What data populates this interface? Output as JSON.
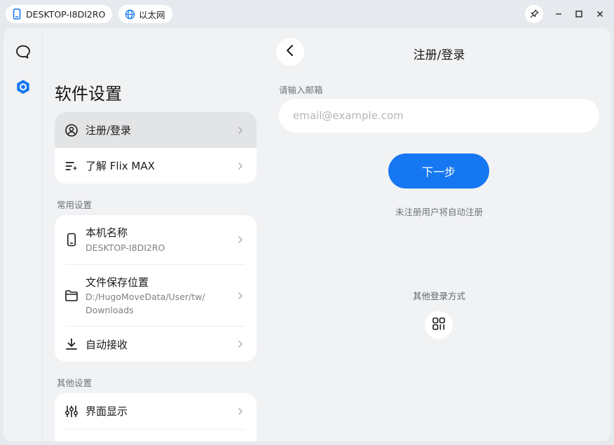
{
  "titlebar": {
    "device_name": "DESKTOP-I8DI2RO",
    "network": "以太网",
    "icons": {
      "device": "phone-icon",
      "network": "globe-icon",
      "pin": "pin-icon",
      "minimize": "minimize-icon",
      "maximize": "maximize-icon",
      "close": "close-icon"
    }
  },
  "rail": {
    "items": [
      {
        "icon": "chat-bubble-icon",
        "active": false
      },
      {
        "icon": "settings-hexagon-icon",
        "active": true
      }
    ],
    "accent": "#1677f2"
  },
  "settings": {
    "title": "软件设置",
    "account_card": [
      {
        "icon": "user-circle-icon",
        "label": "注册/登录",
        "active": true
      },
      {
        "icon": "list-sparkle-icon",
        "label": "了解 Flix MAX"
      }
    ],
    "common_title": "常用设置",
    "common_card": [
      {
        "icon": "phone-icon",
        "label": "本机名称",
        "sub": "DESKTOP-I8DI2RO"
      },
      {
        "icon": "folder-icon",
        "label": "文件保存位置",
        "sub_line1": "D:/HugoMoveData/User/tw/",
        "sub_line2": "Downloads"
      },
      {
        "icon": "download-icon",
        "label": "自动接收"
      }
    ],
    "other_title": "其他设置",
    "other_card": [
      {
        "icon": "sliders-icon",
        "label": "界面显示"
      }
    ]
  },
  "login": {
    "title": "注册/登录",
    "email_label": "请输入邮箱",
    "email_placeholder": "email@example.com",
    "email_value": "",
    "next_label": "下一步",
    "auto_register_note": "未注册用户将自动注册",
    "other_methods": "其他登录方式",
    "icons": {
      "back": "back-arrow-icon",
      "qr": "qr-code-icon"
    },
    "primary_color": "#1677f2"
  }
}
